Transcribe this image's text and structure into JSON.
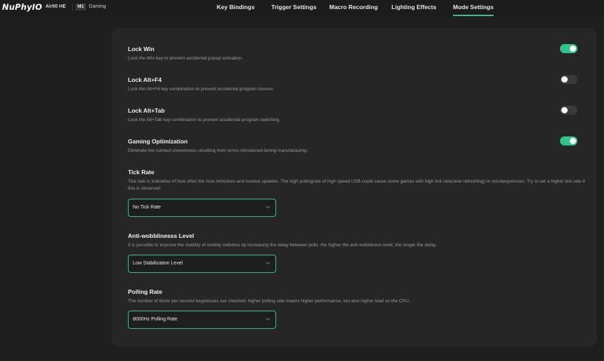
{
  "header": {
    "brand": "NuPhyIO",
    "device_model": "Air60 HE",
    "profile_badge": "M1",
    "profile_name": "Gaming",
    "tabs": [
      {
        "label": "Key Bindings",
        "active": false
      },
      {
        "label": "Trigger Settings",
        "active": false
      },
      {
        "label": "Macro Recording",
        "active": false
      },
      {
        "label": "Lighting Effects",
        "active": false
      },
      {
        "label": "Mode Settings",
        "active": true
      }
    ],
    "accent_color": "#2fc48a"
  },
  "settings": {
    "lock_win": {
      "title": "Lock Win",
      "description": "Lock the Win key to prevent accidental popup activation.",
      "enabled": true
    },
    "lock_alt_f4": {
      "title": "Lock Alt+F4",
      "description": "Lock the Alt+F4 key combination to prevent accidental program closure.",
      "enabled": false
    },
    "lock_alt_tab": {
      "title": "Lock Alt+Tab",
      "description": "Lock the Alt+Tab key combination to prevent accidental program switching.",
      "enabled": false
    },
    "gaming_optimization": {
      "title": "Gaming Optimization",
      "description": "Eliminate the contact unevenness resulting from errors introduced during manufacturing.",
      "enabled": true
    },
    "tick_rate": {
      "title": "Tick Rate",
      "description": "Tick rate is indicative of how often the host refreshes and receive updates. The high pollingrate of high speed USB could cause some games with high tick rate(slow refreshing) to misskeypresses. Try to set a higher tick rate if this is observed.",
      "selected": "No Tick Rate"
    },
    "anti_wobbliness": {
      "title": "Anti-wobblinesss Level",
      "description": "It is possible to improve the stability of wobbly switches by increasing the delay between polls, the higher the anti-wobbliness level, the longer the delay.",
      "selected": "Low Stabilization Level"
    },
    "polling_rate": {
      "title": "Polling Rate",
      "description": "The number of times per second keypresses are checked, higher polling rate means higher performance, but also higher load on the CPU.",
      "selected": "8000Hz Polling Rate"
    }
  }
}
